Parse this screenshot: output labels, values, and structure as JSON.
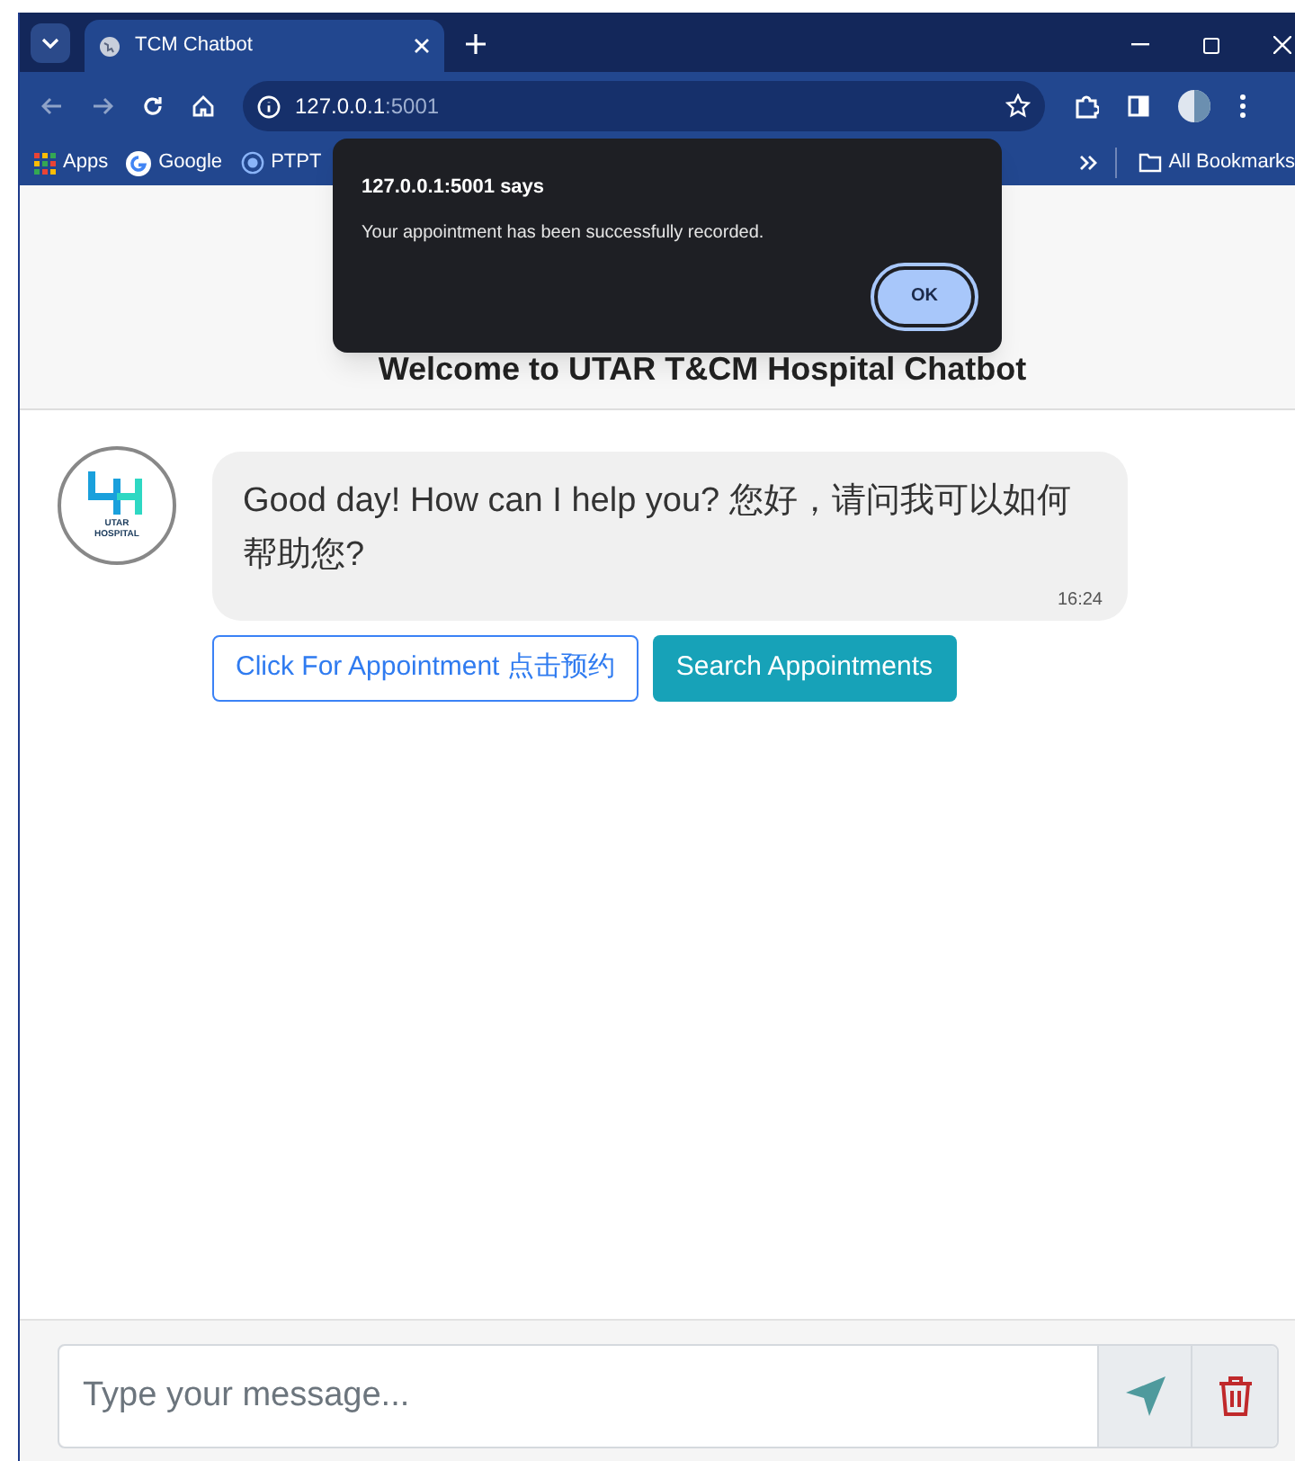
{
  "browser": {
    "tab_title": "TCM Chatbot",
    "url_host": "127.0.0.1",
    "url_port": ":5001",
    "bookmarks": [
      {
        "label": "Apps",
        "kind": "apps"
      },
      {
        "label": "Google",
        "kind": "google"
      },
      {
        "label": "PTPT",
        "kind": "site"
      }
    ],
    "all_bookmarks": "All Bookmarks"
  },
  "dialog": {
    "title": "127.0.0.1:5001 says",
    "message": "Your appointment has been successfully recorded.",
    "button": "OK"
  },
  "header": {
    "title": "Welcome to UTAR T&CM Hospital Chatbot"
  },
  "logo": {
    "text_1": "UTAR",
    "text_2": "HOSPITAL"
  },
  "messages": [
    {
      "text": "Good day! How can I help you? 您好，请问我可以如何帮助您?",
      "time": "16:24"
    }
  ],
  "actions": [
    {
      "label": "Click For Appointment 点击预约",
      "kind": "outline"
    },
    {
      "label": "Search Appointments",
      "kind": "solid"
    }
  ],
  "composer": {
    "placeholder": "Type your message..."
  }
}
